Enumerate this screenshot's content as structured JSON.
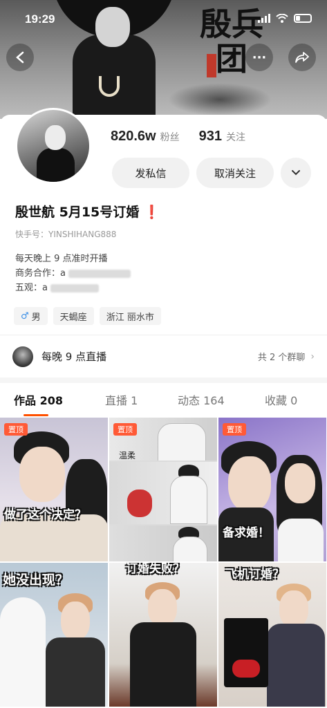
{
  "status_bar": {
    "time": "19:29"
  },
  "banner": {
    "calligraphy": "殷兵团"
  },
  "profile": {
    "followers_count": "820.6w",
    "followers_label": "粉丝",
    "following_count": "931",
    "following_label": "关注",
    "message_button": "发私信",
    "unfollow_button": "取消关注",
    "nickname": "殷世航 5月15号订婚",
    "nickname_mark": "❗",
    "kuaishou_id": "快手号：YINSHIHANG888",
    "bio_line1": "每天晚上 9 点准时开播",
    "bio_line2_label": "商务合作：",
    "bio_line2_value": "a",
    "bio_line3_label": "五观：",
    "bio_line3_value": "a",
    "tags": [
      {
        "icon": "male-icon",
        "label": "男"
      },
      {
        "label": "天蝎座"
      },
      {
        "label": "浙江 丽水市"
      }
    ]
  },
  "group": {
    "title": "每晚 9 点直播",
    "count": "共 2 个群聊"
  },
  "tabs": [
    {
      "label": "作品 208",
      "active": true
    },
    {
      "label": "直播 1",
      "active": false
    },
    {
      "label": "动态 164",
      "active": false
    },
    {
      "label": "收藏 0",
      "active": false
    }
  ],
  "grid": {
    "pin_label": "置顶",
    "tiles": [
      {
        "caption": "做了这个决定？"
      },
      {
        "caption": "温柔"
      },
      {
        "caption": "备求婚！"
      },
      {
        "caption": "她没出现？"
      },
      {
        "caption": "订婚失败？"
      },
      {
        "caption": "飞机订婚？"
      }
    ]
  },
  "colors": {
    "accent": "#ff5000",
    "pin": "#ff5a36",
    "alert": "#e8322f"
  }
}
